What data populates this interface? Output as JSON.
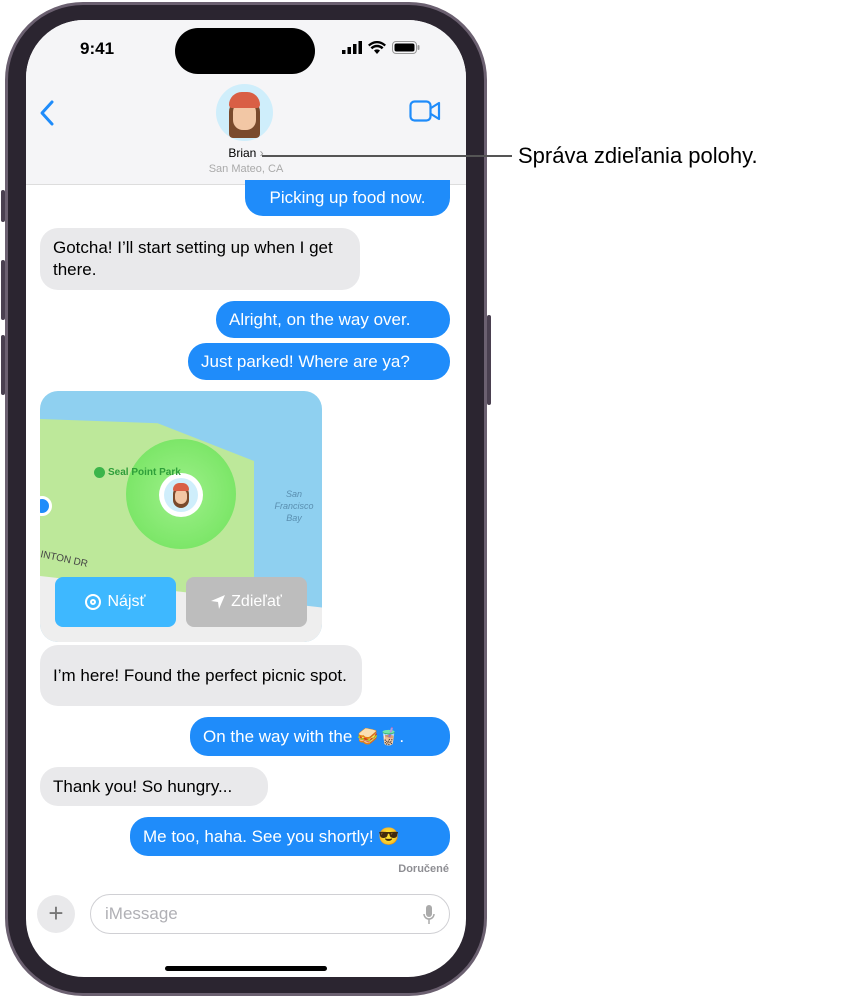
{
  "status_bar": {
    "time": "9:41"
  },
  "header": {
    "contact_name": "Brian",
    "contact_location": "San Mateo, CA",
    "back_icon": "chevron-left-icon",
    "video_icon": "video-camera-icon"
  },
  "messages": [
    {
      "side": "out",
      "text": "Picking up food now."
    },
    {
      "side": "in",
      "text": "Gotcha! I’ll start setting up when I get there."
    },
    {
      "side": "out",
      "text": "Alright, on the way over."
    },
    {
      "side": "out",
      "text": "Just parked! Where are ya?"
    },
    {
      "side": "in",
      "text": "I’m here! Found the perfect picnic spot."
    },
    {
      "side": "out",
      "text": "On the way with the 🥪🧋."
    },
    {
      "side": "in",
      "text": "Thank you! So hungry..."
    },
    {
      "side": "out",
      "text": "Me too, haha. See you shortly! 😎"
    }
  ],
  "map": {
    "park_label": "Seal Point Park",
    "bay_label": "San Francisco Bay",
    "street_label": "INTON DR",
    "find_button": "Nájsť",
    "share_button": "Zdieľať"
  },
  "delivered": "Doručené",
  "composer": {
    "placeholder": "iMessage"
  },
  "callout": "Správa zdieľania polohy.",
  "colors": {
    "accent": "#1f8cfa",
    "incoming": "#e9e9eb"
  }
}
